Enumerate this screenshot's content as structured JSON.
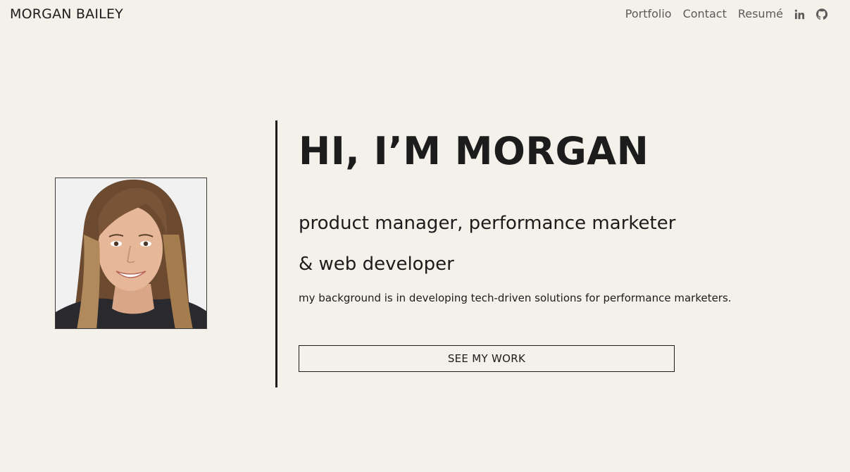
{
  "header": {
    "brand": "MORGAN BAILEY",
    "nav": [
      {
        "label": "Portfolio"
      },
      {
        "label": "Contact"
      },
      {
        "label": "Resumé"
      }
    ],
    "icons": [
      "linkedin-icon",
      "github-icon"
    ]
  },
  "hero": {
    "title": "HI, I’M MORGAN",
    "subtitle_line1": "product manager, performance marketer",
    "subtitle_line2": "& web developer",
    "blurb": "my background is in developing tech-driven solutions for performance marketers.",
    "cta_label": "SEE MY WORK"
  },
  "colors": {
    "background": "#f4f1ea",
    "text": "#1c1c1c",
    "nav_text": "#5a5a5a"
  }
}
